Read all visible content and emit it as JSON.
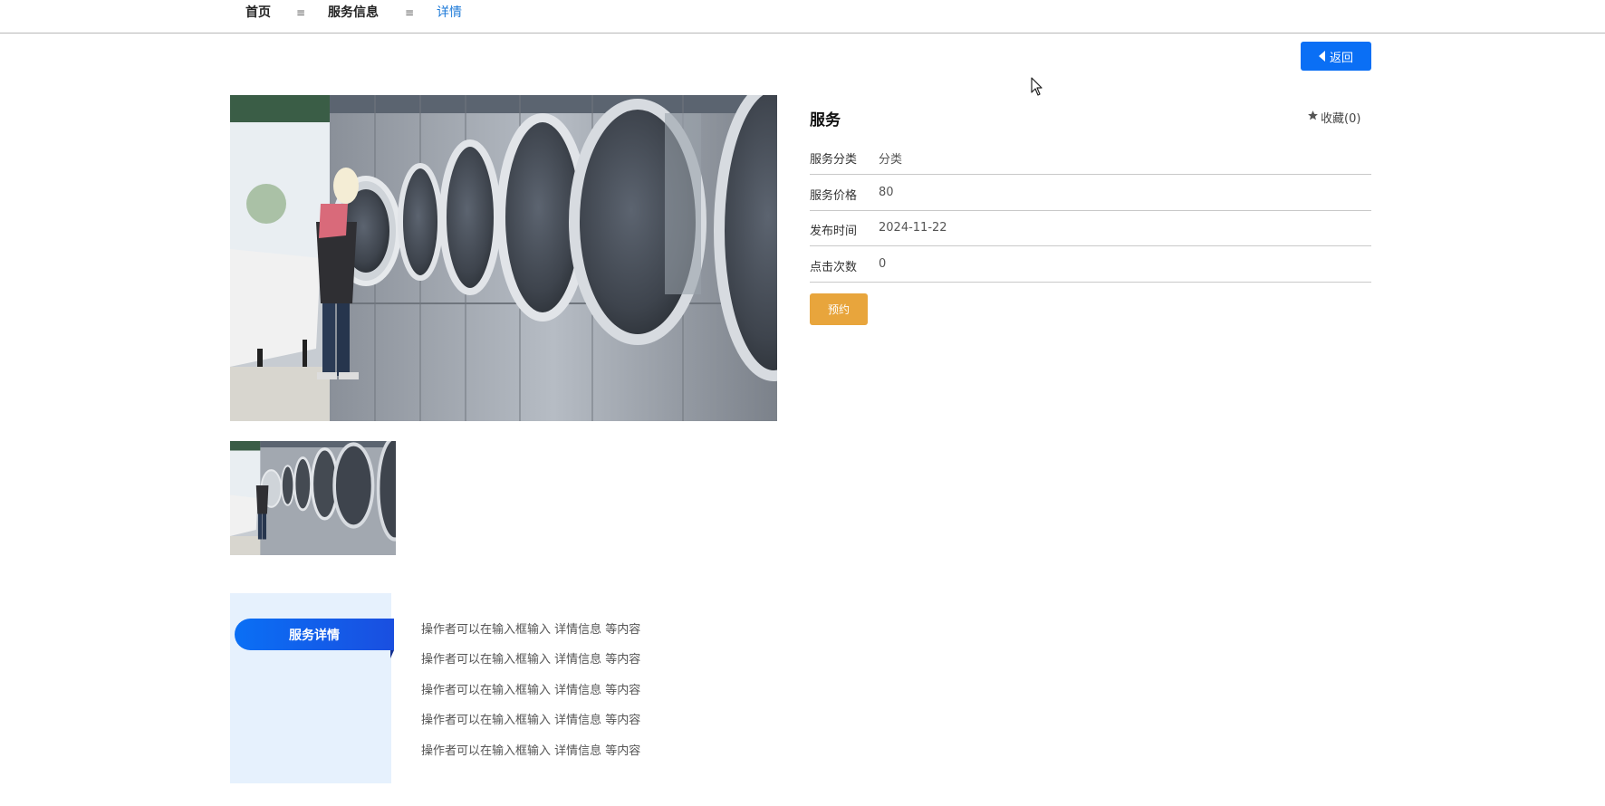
{
  "breadcrumb": {
    "home": "首页",
    "separator": "≡",
    "service_info": "服务信息",
    "current": "详情"
  },
  "back_button": {
    "label": "返回",
    "icon": "caret-left-icon"
  },
  "service": {
    "title": "服务",
    "favorite_label": "收藏(0)",
    "favorite_icon": "star-icon",
    "rows": [
      {
        "label": "服务分类",
        "value": "分类"
      },
      {
        "label": "服务价格",
        "value": "80"
      },
      {
        "label": "发布时间",
        "value": "2024-11-22"
      },
      {
        "label": "点击次数",
        "value": "0"
      }
    ],
    "book_label": "预约"
  },
  "detail": {
    "tab_label": "服务详情",
    "lines": [
      "操作者可以在输入框输入  详情信息  等内容",
      "操作者可以在输入框输入  详情信息  等内容",
      "操作者可以在输入框输入  详情信息  等内容",
      "操作者可以在输入框输入  详情信息  等内容",
      "操作者可以在输入框输入  详情信息  等内容"
    ]
  },
  "colors": {
    "primary": "#0a6ff5",
    "book": "#e8a53c",
    "active_crumb": "#1e7ad8",
    "detail_bg": "#e6f1fd"
  }
}
